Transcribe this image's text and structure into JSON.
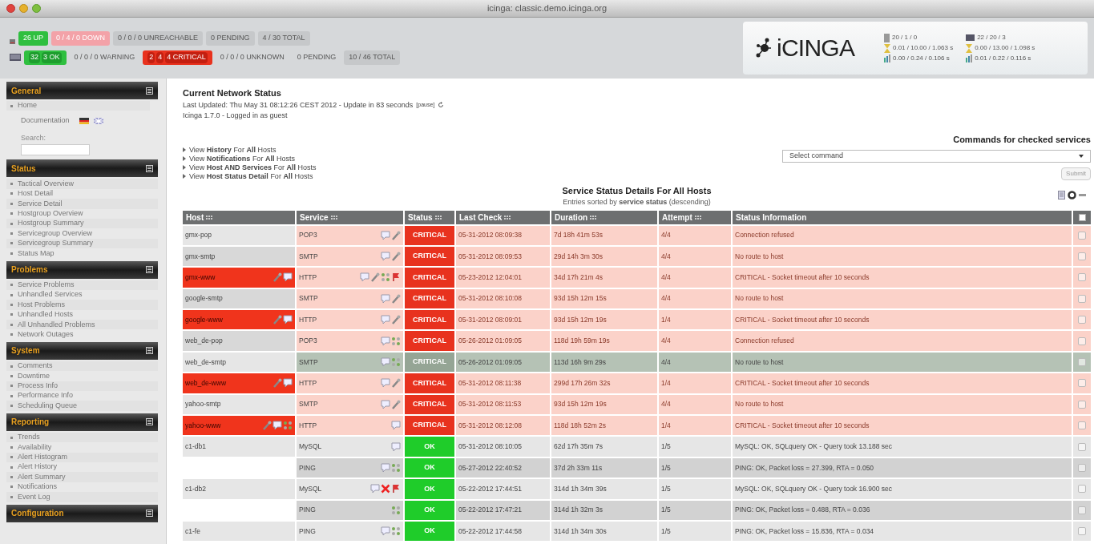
{
  "window": {
    "title": "icinga: classic.demo.icinga.org"
  },
  "host_totals": [
    {
      "parts": [
        "26 UP"
      ],
      "kind": "up"
    },
    {
      "parts": [
        "0 / 4 / 0 DOWN"
      ],
      "kind": "down"
    },
    {
      "parts": [
        "0 / 0 / 0 UNREACHABLE"
      ],
      "kind": "neutral"
    },
    {
      "parts": [
        "0 PENDING"
      ],
      "kind": "neutral"
    },
    {
      "parts": [
        "4 / 30 TOTAL"
      ],
      "kind": "neutral"
    }
  ],
  "service_totals": [
    {
      "parts": [
        "32",
        "3 OK"
      ],
      "kind": "ok"
    },
    {
      "parts": [
        "0 / 0 / 0 WARNING"
      ],
      "kind": "plain"
    },
    {
      "parts": [
        "2",
        "4",
        "4 CRITICAL"
      ],
      "kind": "critical"
    },
    {
      "parts": [
        "0 / 0 / 0 UNKNOWN"
      ],
      "kind": "plain"
    },
    {
      "parts": [
        "0 PENDING"
      ],
      "kind": "plain"
    },
    {
      "parts": [
        "10 / 46 TOTAL"
      ],
      "kind": "neutral"
    }
  ],
  "logo": "iCINGA",
  "stats": [
    [
      "20 / 1 / 0",
      "0.01 / 10.00 / 1.063 s",
      "0.00 / 0.24 / 0.106 s"
    ],
    [
      "22 / 20 / 3",
      "0.00 / 13.00 / 1.098 s",
      "0.01 / 0.22 / 0.116 s"
    ]
  ],
  "sidebar": {
    "general": {
      "title": "General",
      "items": [
        "Home"
      ],
      "documentation": "Documentation",
      "search_label": "Search:"
    },
    "sections": [
      {
        "title": "Status",
        "items": [
          "Tactical Overview",
          "Host Detail",
          "Service Detail",
          "Hostgroup Overview",
          "Hostgroup Summary",
          "Servicegroup Overview",
          "Servicegroup Summary",
          "Status Map"
        ]
      },
      {
        "title": "Problems",
        "items": [
          "Service Problems",
          "Unhandled Services",
          "Host Problems",
          "Unhandled Hosts",
          "All Unhandled Problems",
          "Network Outages"
        ]
      },
      {
        "title": "System",
        "items": [
          "Comments",
          "Downtime",
          "Process Info",
          "Performance Info",
          "Scheduling Queue"
        ]
      },
      {
        "title": "Reporting",
        "items": [
          "Trends",
          "Availability",
          "Alert Histogram",
          "Alert History",
          "Alert Summary",
          "Notifications",
          "Event Log"
        ]
      },
      {
        "title": "Configuration"
      }
    ]
  },
  "header": {
    "title": "Current Network Status",
    "updated": "Last Updated: Thu May 31 08:12:26 CEST 2012 - Update in 83 seconds",
    "pause": "[pause]",
    "version": "Icinga 1.7.0 - Logged in as guest"
  },
  "links": [
    "View **History** For **All** Hosts",
    "View **Notifications** For **All** Hosts",
    "View **Host AND Services** For **All** Hosts",
    "View **Host Status Detail** For **All** Hosts"
  ],
  "commands": {
    "title": "Commands for checked services",
    "select": "Select command",
    "submit": "Submit"
  },
  "table": {
    "title": "Service Status Details For All Hosts",
    "subtitle": "Entries sorted by **service status** (descending)",
    "columns": [
      "Host",
      "Service",
      "Status",
      "Last Check",
      "Duration",
      "Attempt",
      "Status Information"
    ],
    "select_all": {
      "checked": false
    },
    "rows": [
      {
        "host": "gmx-pop",
        "host_down": false,
        "host_icons": [],
        "service": "POP3",
        "icons": [
          {
            "kind": "comment"
          },
          {
            "kind": "wrench"
          }
        ],
        "kind": "critical",
        "status": "CRITICAL",
        "last_check": "05-31-2012 08:09:38",
        "duration": "7d 18h 41m 53s",
        "attempt": "4/4",
        "info": "Connection refused",
        "checked": false
      },
      {
        "host": "gmx-smtp",
        "host_down": false,
        "host_icons": [],
        "service": "SMTP",
        "icons": [
          {
            "kind": "comment"
          },
          {
            "kind": "wrench"
          }
        ],
        "kind": "critical",
        "status": "CRITICAL",
        "last_check": "05-31-2012 08:09:53",
        "duration": "29d 14h 3m 30s",
        "attempt": "4/4",
        "info": "No route to host",
        "checked": false
      },
      {
        "host": "gmx-www",
        "host_down": true,
        "host_icons": [
          {
            "kind": "wrench"
          },
          {
            "kind": "comment"
          }
        ],
        "service": "HTTP",
        "icons": [
          {
            "kind": "comment"
          },
          {
            "kind": "wrench"
          },
          {
            "kind": "dots"
          },
          {
            "kind": "flag"
          }
        ],
        "kind": "critical",
        "status": "CRITICAL",
        "last_check": "05-23-2012 12:04:01",
        "duration": "34d 17h 21m 4s",
        "attempt": "4/4",
        "info": "CRITICAL - Socket timeout after 10 seconds",
        "checked": false
      },
      {
        "host": "google-smtp",
        "host_down": false,
        "host_icons": [],
        "service": "SMTP",
        "icons": [
          {
            "kind": "comment"
          },
          {
            "kind": "wrench"
          }
        ],
        "kind": "critical",
        "status": "CRITICAL",
        "last_check": "05-31-2012 08:10:08",
        "duration": "93d 15h 12m 15s",
        "attempt": "4/4",
        "info": "No route to host",
        "checked": false
      },
      {
        "host": "google-www",
        "host_down": true,
        "host_icons": [
          {
            "kind": "wrench"
          },
          {
            "kind": "comment"
          }
        ],
        "service": "HTTP",
        "icons": [
          {
            "kind": "comment"
          },
          {
            "kind": "wrench"
          }
        ],
        "kind": "critical",
        "status": "CRITICAL",
        "last_check": "05-31-2012 08:09:01",
        "duration": "93d 15h 12m 19s",
        "attempt": "1/4",
        "info": "CRITICAL - Socket timeout after 10 seconds",
        "checked": false
      },
      {
        "host": "web_de-pop",
        "host_down": false,
        "host_icons": [],
        "service": "POP3",
        "icons": [
          {
            "kind": "comment"
          },
          {
            "kind": "dots"
          }
        ],
        "kind": "critical",
        "status": "CRITICAL",
        "last_check": "05-26-2012 01:09:05",
        "duration": "118d 19h 59m 19s",
        "attempt": "4/4",
        "info": "Connection refused",
        "checked": false
      },
      {
        "host": "web_de-smtp",
        "host_down": false,
        "host_icons": [],
        "service": "SMTP",
        "icons": [
          {
            "kind": "comment"
          },
          {
            "kind": "dots"
          }
        ],
        "kind": "acknowledged",
        "status": "CRITICAL",
        "last_check": "05-26-2012 01:09:05",
        "duration": "113d 16h 9m 29s",
        "attempt": "4/4",
        "info": "No route to host",
        "checked": false
      },
      {
        "host": "web_de-www",
        "host_down": true,
        "host_icons": [
          {
            "kind": "wrench"
          },
          {
            "kind": "comment"
          }
        ],
        "service": "HTTP",
        "icons": [
          {
            "kind": "comment"
          },
          {
            "kind": "wrench"
          }
        ],
        "kind": "critical",
        "status": "CRITICAL",
        "last_check": "05-31-2012 08:11:38",
        "duration": "299d 17h 26m 32s",
        "attempt": "1/4",
        "info": "CRITICAL - Socket timeout after 10 seconds",
        "checked": false
      },
      {
        "host": "yahoo-smtp",
        "host_down": false,
        "host_icons": [],
        "service": "SMTP",
        "icons": [
          {
            "kind": "comment"
          },
          {
            "kind": "wrench"
          }
        ],
        "kind": "critical",
        "status": "CRITICAL",
        "last_check": "05-31-2012 08:11:53",
        "duration": "93d 15h 12m 19s",
        "attempt": "4/4",
        "info": "No route to host",
        "checked": false
      },
      {
        "host": "yahoo-www",
        "host_down": true,
        "host_icons": [
          {
            "kind": "wrench"
          },
          {
            "kind": "comment"
          },
          {
            "kind": "dots"
          }
        ],
        "service": "HTTP",
        "icons": [
          {
            "kind": "comment"
          }
        ],
        "kind": "critical",
        "status": "CRITICAL",
        "last_check": "05-31-2012 08:12:08",
        "duration": "118d 18h 52m 2s",
        "attempt": "1/4",
        "info": "CRITICAL - Socket timeout after 10 seconds",
        "checked": false
      },
      {
        "host": "c1-db1",
        "host_down": false,
        "host_icons": [],
        "service": "MySQL",
        "icons": [
          {
            "kind": "comment"
          }
        ],
        "kind": "ok",
        "status": "OK",
        "last_check": "05-31-2012 08:10:05",
        "duration": "62d 17h 35m 7s",
        "attempt": "1/5",
        "info": "MySQL: OK, SQLquery OK - Query took 13.188 sec",
        "checked": false
      },
      {
        "host_down": false,
        "host_icons": [],
        "service": "PING",
        "icons": [
          {
            "kind": "comment"
          },
          {
            "kind": "dots"
          }
        ],
        "kind": "ok",
        "status": "OK",
        "last_check": "05-27-2012 22:40:52",
        "duration": "37d 2h 33m 11s",
        "attempt": "1/5",
        "info": "PING: OK, Packet loss = 27.399, RTA = 0.050",
        "checked": false
      },
      {
        "host": "c1-db2",
        "host_down": false,
        "host_icons": [],
        "service": "MySQL",
        "icons": [
          {
            "kind": "comment"
          },
          {
            "kind": "x"
          },
          {
            "kind": "flag"
          }
        ],
        "kind": "ok",
        "status": "OK",
        "last_check": "05-22-2012 17:44:51",
        "duration": "314d 1h 34m 39s",
        "attempt": "1/5",
        "info": "MySQL: OK, SQLquery OK - Query took 16.900 sec",
        "checked": false
      },
      {
        "host_down": false,
        "host_icons": [],
        "service": "PING",
        "icons": [
          {
            "kind": "dots"
          }
        ],
        "kind": "ok",
        "status": "OK",
        "last_check": "05-22-2012 17:47:21",
        "duration": "314d 1h 32m 3s",
        "attempt": "1/5",
        "info": "PING: OK, Packet loss = 0.488, RTA = 0.036",
        "checked": false
      },
      {
        "host": "c1-fe",
        "host_down": false,
        "host_icons": [],
        "service": "PING",
        "icons": [
          {
            "kind": "comment"
          },
          {
            "kind": "dots"
          }
        ],
        "kind": "ok",
        "status": "OK",
        "last_check": "05-22-2012 17:44:58",
        "duration": "314d 1h 34m 30s",
        "attempt": "1/5",
        "info": "PING: OK, Packet loss = 15.836, RTA = 0.034",
        "checked": false
      }
    ]
  }
}
